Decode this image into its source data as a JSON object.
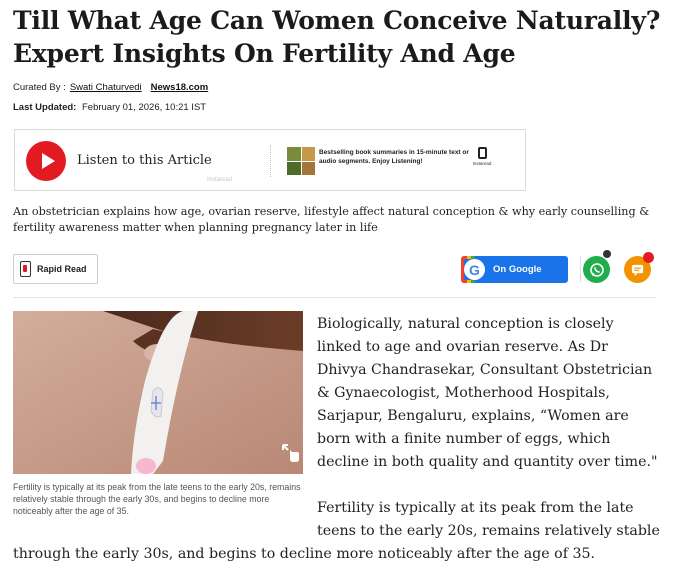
{
  "article": {
    "headline": "Till What Age Can Women Conceive Naturally? Expert Insights On Fertility And Age",
    "curated_by_label": "Curated By :",
    "curator": "Swati Chaturvedi",
    "source": "News18.com",
    "last_updated_label": "Last Updated:",
    "last_updated": "February 01, 2026, 10:21 IST",
    "summary": "An obstetrician explains how age, ovarian reserve, lifestyle affect natural conception & why early counselling & fertility awareness matter when planning pregnancy later in life"
  },
  "audio": {
    "listen_label": "Listen to this Article",
    "ad_text": "Bestselling book summaries in 15-minute text or audio segments. Enjoy Listening!",
    "ad_logo_text": "Instaread",
    "brand_label": "Instaread"
  },
  "actions": {
    "rapid_read_label": "Rapid Read",
    "google_label": "On Google",
    "google_letter": "G"
  },
  "media": {
    "caption": "Fertility is typically at its peak from the late teens to the early 20s, remains relatively stable through the early 30s, and begins to decline more noticeably after the age of 35."
  },
  "body": {
    "p1": "Biologically, natural conception is closely linked to age and ovarian reserve. As Dr Dhivya Chandrasekar, Consultant Obstetrician & Gynaecologist, Motherhood Hospitals, Sarjapur, Bengaluru, explains, “Women are born with a finite number of eggs, which decline in both quality and quantity over time.\"",
    "p2_start": "Fertility is typically at its peak from the late teens to the early 20s, remains relatively stable",
    "p2_end": "through the early 30s, and begins to decline more noticeably after the age of 35."
  },
  "colors": {
    "brand_red": "#e21b23",
    "google_blue": "#1a73e8",
    "whatsapp_green": "#1fae4b",
    "comment_orange": "#f39200"
  },
  "icons": [
    "play-icon",
    "rapid-read-icon",
    "google-icon",
    "whatsapp-icon",
    "comment-icon",
    "zoom-icon"
  ]
}
